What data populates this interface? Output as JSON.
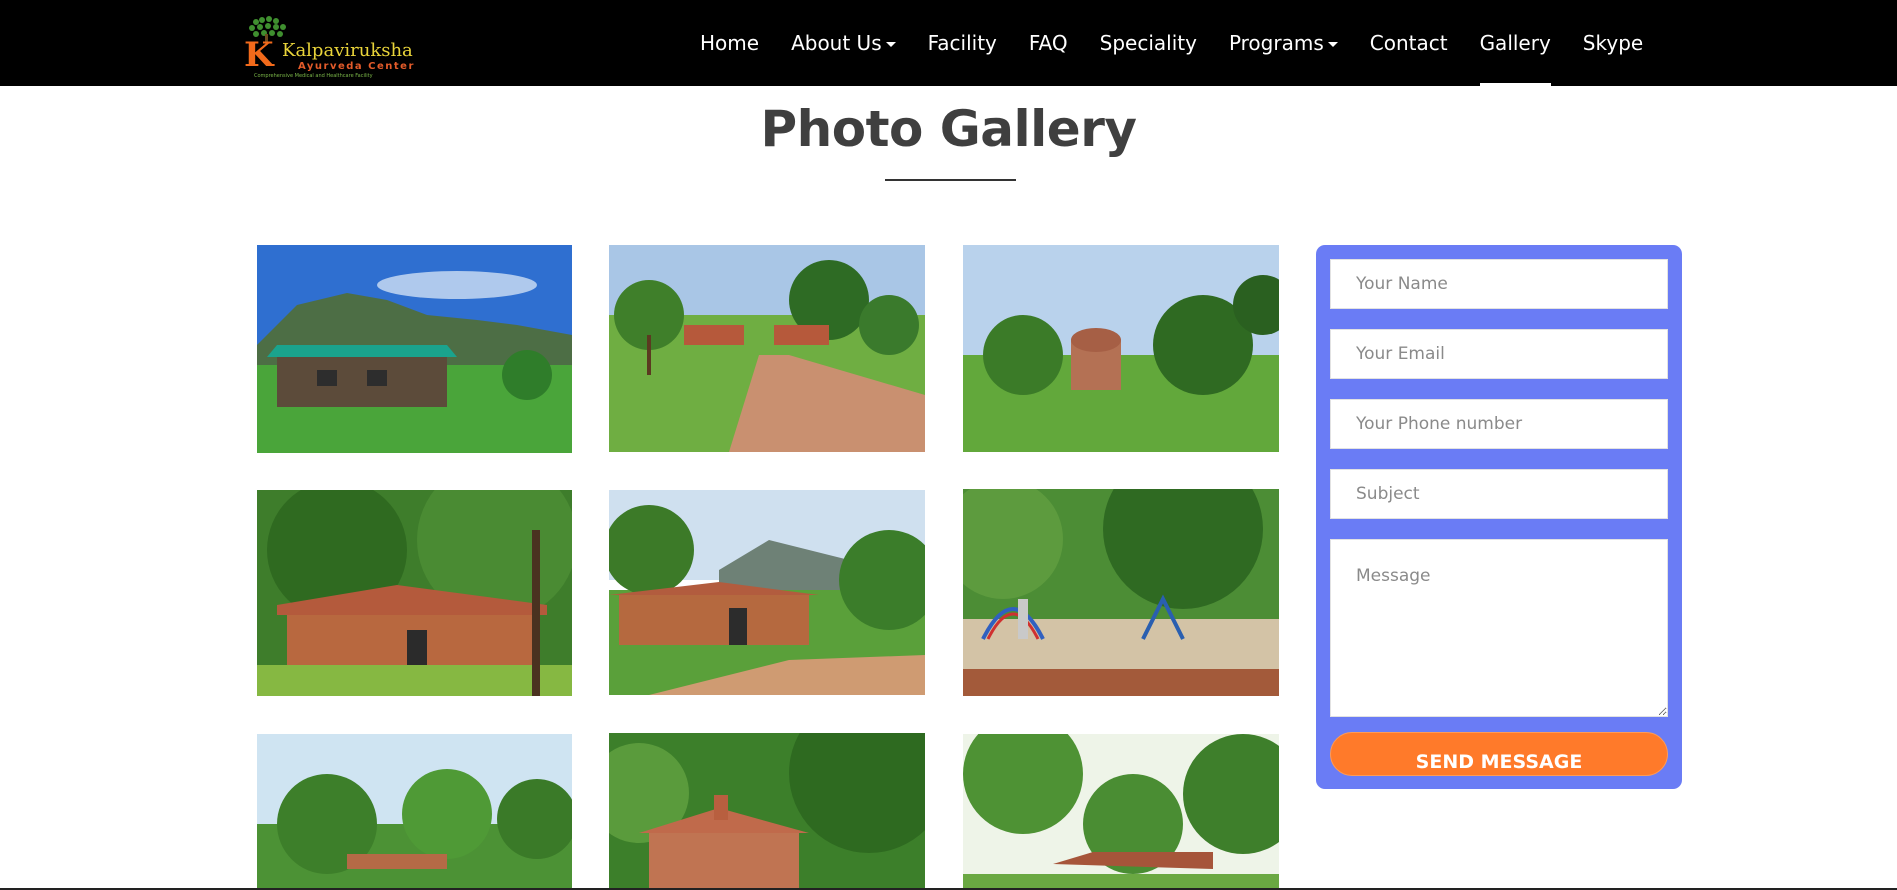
{
  "brand": {
    "name": "Kalpaviruksha",
    "subtitle": "Ayurveda Center",
    "tagline": "Comprehensive Medical and Healthcare Facility",
    "letter": "K"
  },
  "nav": {
    "items": [
      {
        "label": "Home",
        "dropdown": false,
        "active": false
      },
      {
        "label": "About Us",
        "dropdown": true,
        "active": false
      },
      {
        "label": "Facility",
        "dropdown": false,
        "active": false
      },
      {
        "label": "FAQ",
        "dropdown": false,
        "active": false
      },
      {
        "label": "Speciality",
        "dropdown": false,
        "active": false
      },
      {
        "label": "Programs",
        "dropdown": true,
        "active": false
      },
      {
        "label": "Contact",
        "dropdown": false,
        "active": false
      },
      {
        "label": "Gallery",
        "dropdown": false,
        "active": true
      },
      {
        "label": "Skype",
        "dropdown": false,
        "active": false
      }
    ]
  },
  "page": {
    "title": "Photo Gallery"
  },
  "form": {
    "name_placeholder": "Your Name",
    "email_placeholder": "Your Email",
    "phone_placeholder": "Your Phone number",
    "subject_placeholder": "Subject",
    "message_placeholder": "Message",
    "submit_label": "SEND MESSAGE"
  },
  "colors": {
    "navbar": "#000000",
    "form_background": "#6a7cf5",
    "button": "#ff7a2a",
    "title": "#3f3f3f"
  }
}
